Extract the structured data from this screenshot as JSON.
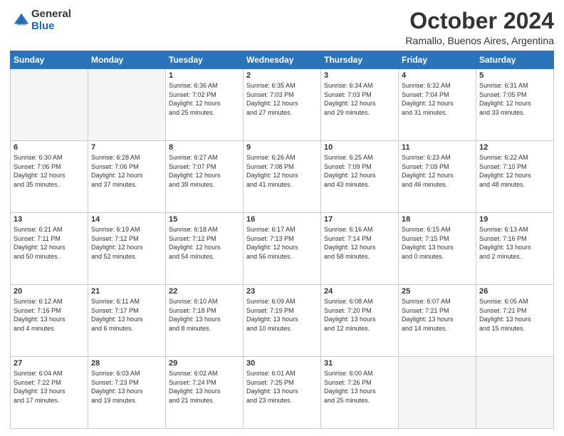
{
  "logo": {
    "general": "General",
    "blue": "Blue"
  },
  "header": {
    "month": "October 2024",
    "location": "Ramallo, Buenos Aires, Argentina"
  },
  "days_of_week": [
    "Sunday",
    "Monday",
    "Tuesday",
    "Wednesday",
    "Thursday",
    "Friday",
    "Saturday"
  ],
  "weeks": [
    [
      {
        "day": "",
        "info": ""
      },
      {
        "day": "",
        "info": ""
      },
      {
        "day": "1",
        "info": "Sunrise: 6:36 AM\nSunset: 7:02 PM\nDaylight: 12 hours\nand 25 minutes."
      },
      {
        "day": "2",
        "info": "Sunrise: 6:35 AM\nSunset: 7:03 PM\nDaylight: 12 hours\nand 27 minutes."
      },
      {
        "day": "3",
        "info": "Sunrise: 6:34 AM\nSunset: 7:03 PM\nDaylight: 12 hours\nand 29 minutes."
      },
      {
        "day": "4",
        "info": "Sunrise: 6:32 AM\nSunset: 7:04 PM\nDaylight: 12 hours\nand 31 minutes."
      },
      {
        "day": "5",
        "info": "Sunrise: 6:31 AM\nSunset: 7:05 PM\nDaylight: 12 hours\nand 33 minutes."
      }
    ],
    [
      {
        "day": "6",
        "info": "Sunrise: 6:30 AM\nSunset: 7:06 PM\nDaylight: 12 hours\nand 35 minutes."
      },
      {
        "day": "7",
        "info": "Sunrise: 6:28 AM\nSunset: 7:06 PM\nDaylight: 12 hours\nand 37 minutes."
      },
      {
        "day": "8",
        "info": "Sunrise: 6:27 AM\nSunset: 7:07 PM\nDaylight: 12 hours\nand 39 minutes."
      },
      {
        "day": "9",
        "info": "Sunrise: 6:26 AM\nSunset: 7:08 PM\nDaylight: 12 hours\nand 41 minutes."
      },
      {
        "day": "10",
        "info": "Sunrise: 6:25 AM\nSunset: 7:09 PM\nDaylight: 12 hours\nand 43 minutes."
      },
      {
        "day": "11",
        "info": "Sunrise: 6:23 AM\nSunset: 7:09 PM\nDaylight: 12 hours\nand 46 minutes."
      },
      {
        "day": "12",
        "info": "Sunrise: 6:22 AM\nSunset: 7:10 PM\nDaylight: 12 hours\nand 48 minutes."
      }
    ],
    [
      {
        "day": "13",
        "info": "Sunrise: 6:21 AM\nSunset: 7:11 PM\nDaylight: 12 hours\nand 50 minutes."
      },
      {
        "day": "14",
        "info": "Sunrise: 6:19 AM\nSunset: 7:12 PM\nDaylight: 12 hours\nand 52 minutes."
      },
      {
        "day": "15",
        "info": "Sunrise: 6:18 AM\nSunset: 7:12 PM\nDaylight: 12 hours\nand 54 minutes."
      },
      {
        "day": "16",
        "info": "Sunrise: 6:17 AM\nSunset: 7:13 PM\nDaylight: 12 hours\nand 56 minutes."
      },
      {
        "day": "17",
        "info": "Sunrise: 6:16 AM\nSunset: 7:14 PM\nDaylight: 12 hours\nand 58 minutes."
      },
      {
        "day": "18",
        "info": "Sunrise: 6:15 AM\nSunset: 7:15 PM\nDaylight: 13 hours\nand 0 minutes."
      },
      {
        "day": "19",
        "info": "Sunrise: 6:13 AM\nSunset: 7:16 PM\nDaylight: 13 hours\nand 2 minutes."
      }
    ],
    [
      {
        "day": "20",
        "info": "Sunrise: 6:12 AM\nSunset: 7:16 PM\nDaylight: 13 hours\nand 4 minutes."
      },
      {
        "day": "21",
        "info": "Sunrise: 6:11 AM\nSunset: 7:17 PM\nDaylight: 13 hours\nand 6 minutes."
      },
      {
        "day": "22",
        "info": "Sunrise: 6:10 AM\nSunset: 7:18 PM\nDaylight: 13 hours\nand 8 minutes."
      },
      {
        "day": "23",
        "info": "Sunrise: 6:09 AM\nSunset: 7:19 PM\nDaylight: 13 hours\nand 10 minutes."
      },
      {
        "day": "24",
        "info": "Sunrise: 6:08 AM\nSunset: 7:20 PM\nDaylight: 13 hours\nand 12 minutes."
      },
      {
        "day": "25",
        "info": "Sunrise: 6:07 AM\nSunset: 7:21 PM\nDaylight: 13 hours\nand 14 minutes."
      },
      {
        "day": "26",
        "info": "Sunrise: 6:05 AM\nSunset: 7:21 PM\nDaylight: 13 hours\nand 15 minutes."
      }
    ],
    [
      {
        "day": "27",
        "info": "Sunrise: 6:04 AM\nSunset: 7:22 PM\nDaylight: 13 hours\nand 17 minutes."
      },
      {
        "day": "28",
        "info": "Sunrise: 6:03 AM\nSunset: 7:23 PM\nDaylight: 13 hours\nand 19 minutes."
      },
      {
        "day": "29",
        "info": "Sunrise: 6:02 AM\nSunset: 7:24 PM\nDaylight: 13 hours\nand 21 minutes."
      },
      {
        "day": "30",
        "info": "Sunrise: 6:01 AM\nSunset: 7:25 PM\nDaylight: 13 hours\nand 23 minutes."
      },
      {
        "day": "31",
        "info": "Sunrise: 6:00 AM\nSunset: 7:26 PM\nDaylight: 13 hours\nand 25 minutes."
      },
      {
        "day": "",
        "info": ""
      },
      {
        "day": "",
        "info": ""
      }
    ]
  ]
}
